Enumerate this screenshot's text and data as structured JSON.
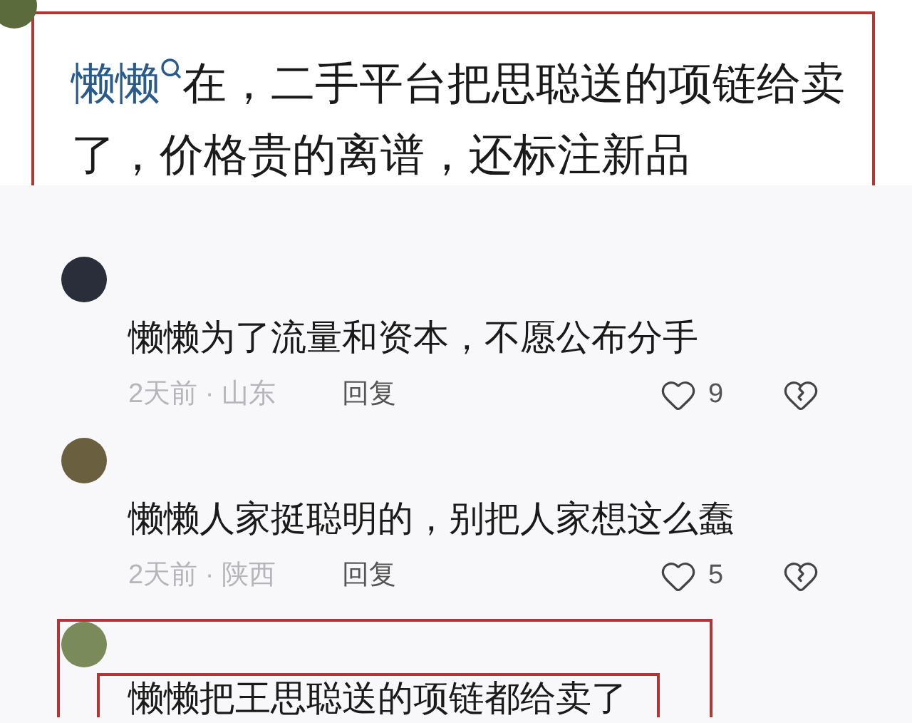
{
  "post": {
    "mention": "懒懒",
    "text": "在，二手平台把思聪送的项链给卖了，价格贵的离谱，还标注新品",
    "highlighted": true
  },
  "comments": [
    {
      "text": "懒懒为了流量和资本，不愿公布分手",
      "time": "2天前 · 山东",
      "reply": "回复",
      "likes": "9",
      "highlighted": false
    },
    {
      "text": "懒懒人家挺聪明的，别把人家想这么蠢",
      "time": "2天前 · 陕西",
      "reply": "回复",
      "likes": "5",
      "highlighted": false
    },
    {
      "text": "懒懒把王思聪送的项链都给卖了",
      "highlighted": true
    }
  ]
}
